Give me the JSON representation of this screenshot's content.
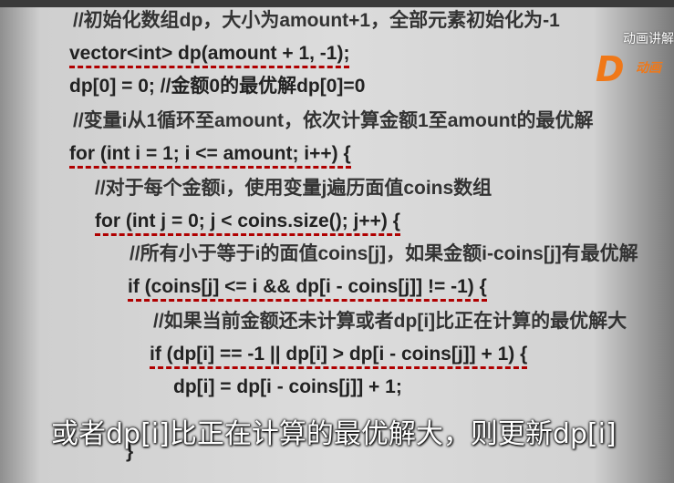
{
  "code_lines": [
    {
      "text": "//初始化数组dp，大小为amount+1，全部元素初始化为-1"
    },
    {
      "text": "vector<int> dp(amount + 1, -1);"
    },
    {
      "text": "dp[0] = 0; //金额0的最优解dp[0]=0"
    },
    {
      "text": "//变量i从1循环至amount，依次计算金额1至amount的最优解"
    },
    {
      "text": "for (int i = 1; i <= amount; i++) {"
    },
    {
      "text": "//对于每个金额i，使用变量j遍历面值coins数组"
    },
    {
      "text": "for (int j = 0; j < coins.size(); j++) {"
    },
    {
      "text": "//所有小于等于i的面值coins[j]，如果金额i-coins[j]有最优解"
    },
    {
      "text": "if (coins[j] <= i && dp[i - coins[j]] != -1) {"
    },
    {
      "text": "//如果当前金额还未计算或者dp[i]比正在计算的最优解大"
    },
    {
      "text": "if (dp[i] == -1 || dp[i] > dp[i - coins[j]] + 1) {"
    },
    {
      "text": "dp[i] = dp[i - coins[j]] + 1;"
    },
    {
      "text": "}"
    }
  ],
  "subtitle": "或者dp[i]比正在计算的最优解大，则更新dp[i]",
  "logo": {
    "title": "动画讲解",
    "mark": "D",
    "sub": "动画"
  },
  "colors": {
    "keyword": "#1f3c8a",
    "number": "#a00000",
    "underline": "#b00000",
    "logo": "#f07818"
  }
}
